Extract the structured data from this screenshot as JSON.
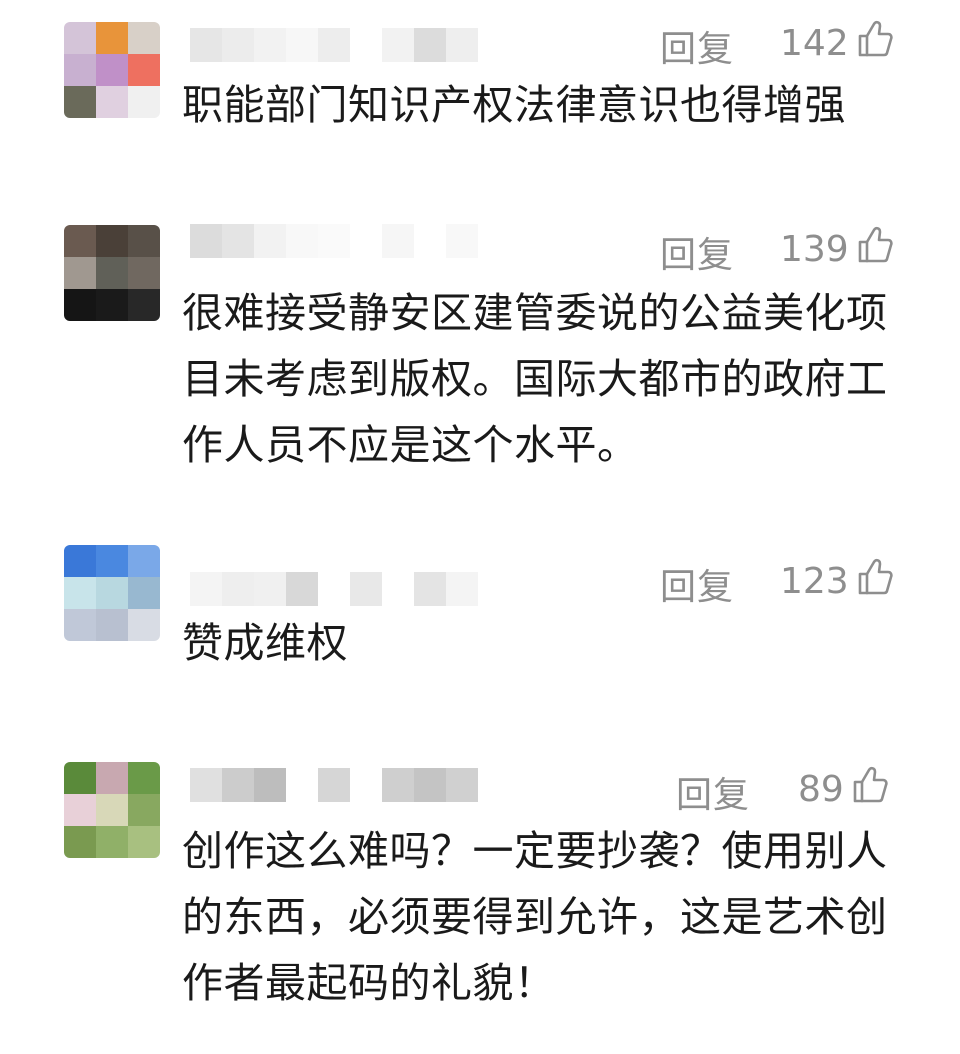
{
  "comments": [
    {
      "reply_label": "回复",
      "like_count": "142",
      "text": "职能部门知识产权法律意识也得增强",
      "avatar_colors": [
        "#d4c4d8",
        "#e8943a",
        "#d8d0c8",
        "#c8b0d0",
        "#c090c8",
        "#ee7060",
        "#6a6a5a",
        "#e0d0e0",
        "#f0f0f0"
      ],
      "name_colors": [
        "#e6e6e6",
        "#ececec",
        "#f2f2f2",
        "#f7f7f7",
        "#ededed",
        "#ffffff",
        "#f2f2f2",
        "#dcdcdc",
        "#eeeeee"
      ]
    },
    {
      "reply_label": "回复",
      "like_count": "139",
      "text": "很难接受静安区建管委说的公益美化项目未考虑到版权。国际大都市的政府工作人员不应是这个水平。",
      "avatar_colors": [
        "#6a5a50",
        "#4a4038",
        "#585048",
        "#a09890",
        "#606058",
        "#706860",
        "#151515",
        "#1a1a1a",
        "#282828"
      ],
      "name_colors": [
        "#dcdcdc",
        "#e4e4e4",
        "#f2f2f2",
        "#f8f8f8",
        "#fafafa",
        "#ffffff",
        "#f6f6f6",
        "#ffffff",
        "#f8f8f8"
      ]
    },
    {
      "reply_label": "回复",
      "like_count": "123",
      "text": "赞成维权",
      "avatar_colors": [
        "#3a78d8",
        "#4a88e0",
        "#7aa8e8",
        "#c8e4ea",
        "#b8d8e0",
        "#98b8d0",
        "#c0c8d8",
        "#b8c0d0",
        "#d8dce4"
      ],
      "name_colors": [
        "#f4f4f4",
        "#eeeeee",
        "#f0f0f0",
        "#d8d8d8",
        "#ffffff",
        "#e8e8e8",
        "#ffffff",
        "#e4e4e4",
        "#f4f4f4"
      ]
    },
    {
      "reply_label": "回复",
      "like_count": "89",
      "text": "创作这么难吗？一定要抄袭？使用别人的东西，必须要得到允许，这是艺术创作者最起码的礼貌！",
      "avatar_colors": [
        "#5a8a3a",
        "#c8a8b0",
        "#6a9a48",
        "#e8d0d8",
        "#d8d8b8",
        "#88a860",
        "#7a9a50",
        "#90b068",
        "#a8c080"
      ],
      "name_colors": [
        "#e0e0e0",
        "#cccccc",
        "#bdbdbd",
        "#ffffff",
        "#d6d6d6",
        "#ffffff",
        "#cfcfcf",
        "#c4c4c4",
        "#d0d0d0"
      ]
    }
  ]
}
